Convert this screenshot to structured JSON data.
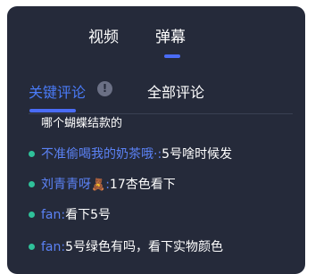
{
  "top_tabs": {
    "video_label": "视频",
    "danmu_label": "弹幕"
  },
  "sub_tabs": {
    "key_comments_label": "关键评论",
    "info_symbol": "!",
    "all_comments_label": "全部评论"
  },
  "comments": {
    "partial_top": "哪个蝴蝶结款的",
    "items": [
      {
        "user": "不准偷喝我的奶茶哦·",
        "separator": ":",
        "text": "5号啥时候发"
      },
      {
        "user": "刘青青呀",
        "emoji": "🧸",
        "separator": ":",
        "text": "17杏色看下"
      },
      {
        "user": "fan",
        "separator": ":",
        "text": "看下5号"
      },
      {
        "user": "fan",
        "separator": ":",
        "text": "5号绿色有吗，看下实物颜色"
      }
    ]
  },
  "colors": {
    "panel_bg": "#252a3a",
    "accent_blue": "#4a6cf7",
    "username_blue": "#5b82f5",
    "dot_green": "#2fc19a"
  }
}
